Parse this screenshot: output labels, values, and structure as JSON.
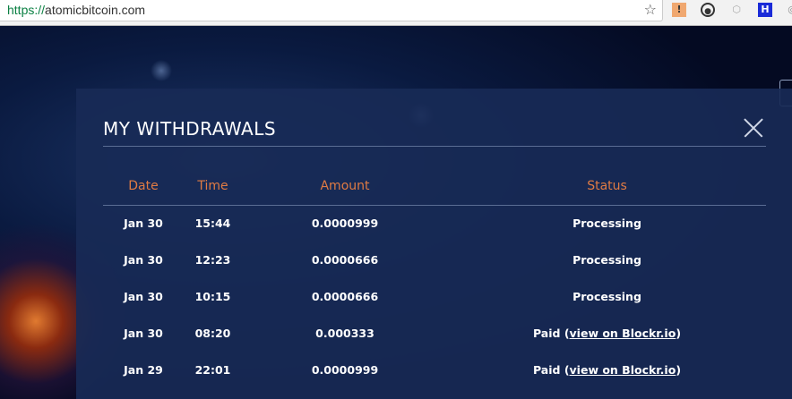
{
  "browser": {
    "url_scheme": "https://",
    "url_host": "atomicbitcoin.com"
  },
  "modal": {
    "title": "MY WITHDRAWALS",
    "columns": [
      "Date",
      "Time",
      "Amount",
      "Status"
    ],
    "rows": [
      {
        "date": "Jan 30",
        "time": "15:44",
        "amount": "0.0000999",
        "status": "Processing",
        "link": ""
      },
      {
        "date": "Jan 30",
        "time": "12:23",
        "amount": "0.0000666",
        "status": "Processing",
        "link": ""
      },
      {
        "date": "Jan 30",
        "time": "10:15",
        "amount": "0.0000666",
        "status": "Processing",
        "link": ""
      },
      {
        "date": "Jan 30",
        "time": "08:20",
        "amount": "0.000333",
        "status": "Paid (",
        "link": "view on Blockr.io"
      },
      {
        "date": "Jan 29",
        "time": "22:01",
        "amount": "0.0000999",
        "status": "Paid (",
        "link": "view on Blockr.io"
      }
    ]
  },
  "colors": {
    "header": "#e07b43",
    "accent_bg": "#182a56"
  }
}
